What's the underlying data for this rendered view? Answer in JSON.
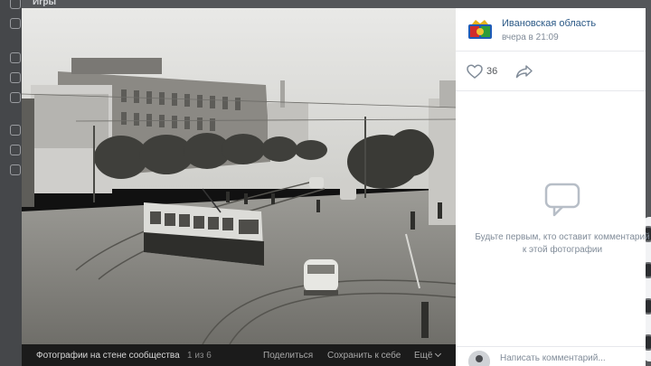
{
  "background": {
    "top_label": "Игры"
  },
  "viewer": {
    "photo_alt": "",
    "bottom_bar": {
      "title": "Фотографии на стене сообщества",
      "counter": "1 из 6",
      "share": "Поделиться",
      "save": "Сохранить к себе",
      "more": "Ещё"
    }
  },
  "side_panel": {
    "group": {
      "name": "Ивановская область",
      "time": "вчера в 21:09",
      "logo_icon": "coat-of-arms-icon"
    },
    "actions": {
      "likes": "36",
      "like_icon": "heart-icon",
      "share_icon": "share-arrow-icon"
    },
    "comments": {
      "empty_icon": "speech-bubble-icon",
      "empty_text": "Будьте первым, кто оставит комментарий к этой фотографии",
      "input_placeholder": "Написать комментарий..."
    }
  },
  "colors": {
    "link": "#2a5885",
    "muted": "#818c99",
    "panel_bg": "#ffffff",
    "bar_bg": "#1b1b1b"
  }
}
